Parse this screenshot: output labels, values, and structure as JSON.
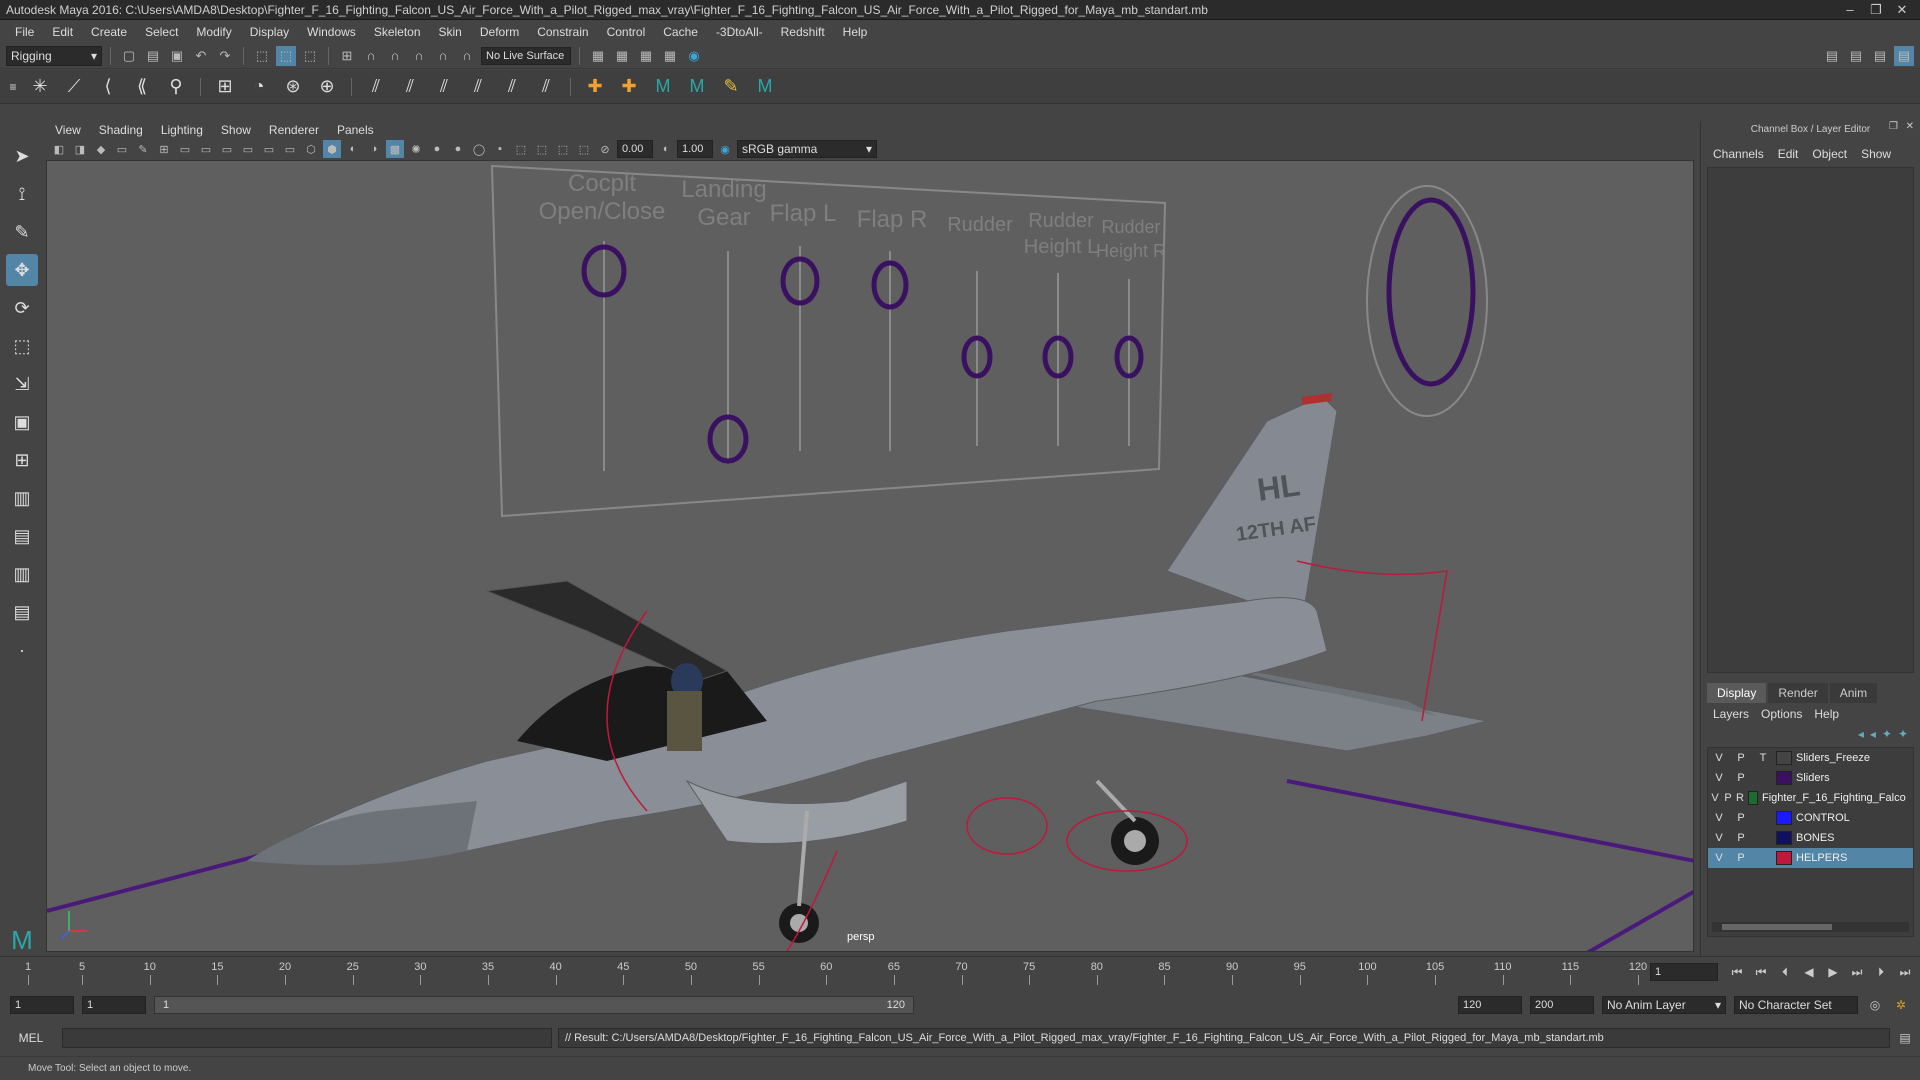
{
  "window": {
    "title": "Autodesk Maya 2016: C:\\Users\\AMDA8\\Desktop\\Fighter_F_16_Fighting_Falcon_US_Air_Force_With_a_Pilot_Rigged_max_vray\\Fighter_F_16_Fighting_Falcon_US_Air_Force_With_a_Pilot_Rigged_for_Maya_mb_standart.mb",
    "minimize": "–",
    "maximize": "❐",
    "close": "✕"
  },
  "menubar": [
    "File",
    "Edit",
    "Create",
    "Select",
    "Modify",
    "Display",
    "Windows",
    "Skeleton",
    "Skin",
    "Deform",
    "Constrain",
    "Control",
    "Cache",
    "-3DtoAll-",
    "Redshift",
    "Help"
  ],
  "toolbar": {
    "mode": "Rigging",
    "live_surface": "No Live Surface"
  },
  "panel": {
    "menu": [
      "View",
      "Shading",
      "Lighting",
      "Show",
      "Renderer",
      "Panels"
    ],
    "exposure": "0.00",
    "gamma": "1.00",
    "color_space": "sRGB gamma",
    "camera_label": "persp"
  },
  "scene": {
    "slider_labels": [
      {
        "line1": "Cocplt",
        "line2": "Open/Close"
      },
      {
        "line1": "Landing",
        "line2": "Gear"
      },
      {
        "line1": "Flap L",
        "line2": ""
      },
      {
        "line1": "Flap R",
        "line2": ""
      },
      {
        "line1": "Rudder",
        "line2": ""
      },
      {
        "line1": "Rudder",
        "line2": "Height L"
      },
      {
        "line1": "Rudder",
        "line2": "Height R"
      }
    ],
    "tail_code": "HL",
    "tail_unit": "12TH AF"
  },
  "channelbox": {
    "title": "Channel Box / Layer Editor",
    "menu": [
      "Channels",
      "Edit",
      "Object",
      "Show"
    ],
    "layer_tabs": [
      "Display",
      "Render",
      "Anim"
    ],
    "layer_menu": [
      "Layers",
      "Options",
      "Help"
    ],
    "layers": [
      {
        "v": "V",
        "p": "P",
        "t": "T",
        "name": "Sliders_Freeze",
        "color": "#444444",
        "selected": false
      },
      {
        "v": "V",
        "p": "P",
        "t": "",
        "name": "Sliders",
        "color": "#3a1060",
        "selected": false
      },
      {
        "v": "V",
        "p": "P",
        "t": "R",
        "name": "Fighter_F_16_Fighting_Falco",
        "color": "#1f6b2f",
        "selected": false
      },
      {
        "v": "V",
        "p": "P",
        "t": "",
        "name": "CONTROL",
        "color": "#1a1aff",
        "selected": false
      },
      {
        "v": "V",
        "p": "P",
        "t": "",
        "name": "BONES",
        "color": "#101060",
        "selected": false
      },
      {
        "v": "V",
        "p": "P",
        "t": "",
        "name": "HELPERS",
        "color": "#c0183a",
        "selected": true
      }
    ]
  },
  "timeline": {
    "ticks": [
      "1",
      "5",
      "10",
      "15",
      "20",
      "25",
      "30",
      "35",
      "40",
      "45",
      "50",
      "55",
      "60",
      "65",
      "70",
      "75",
      "80",
      "85",
      "90",
      "95",
      "100",
      "105",
      "110",
      "115",
      "120"
    ],
    "current_frame": "1"
  },
  "range": {
    "start": "1",
    "playback_start": "1",
    "slider_start": "1",
    "slider_end": "120",
    "playback_end": "120",
    "end": "200",
    "anim_layer": "No Anim Layer",
    "character_set": "No Character Set"
  },
  "commandline": {
    "lang": "MEL",
    "result": "// Result: C:/Users/AMDA8/Desktop/Fighter_F_16_Fighting_Falcon_US_Air_Force_With_a_Pilot_Rigged_max_vray/Fighter_F_16_Fighting_Falcon_US_Air_Force_With_a_Pilot_Rigged_for_Maya_mb_standart.mb"
  },
  "helpline": "Move Tool: Select an object to move."
}
